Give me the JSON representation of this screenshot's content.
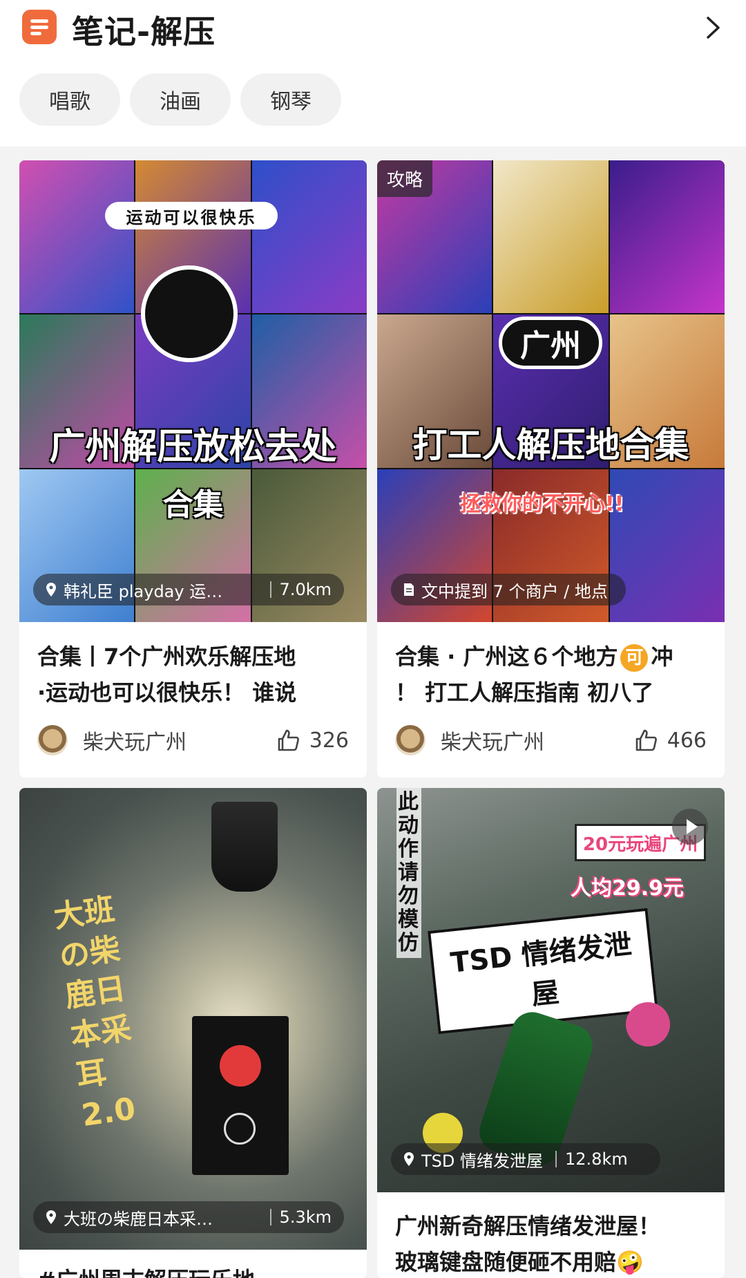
{
  "header": {
    "title": "笔记-解压",
    "icon": "notebook-icon",
    "accent": "#f06b3c"
  },
  "chips": [
    "唱歌",
    "油画",
    "钢琴"
  ],
  "cards": [
    {
      "cover_title_top": "运动可以很快乐",
      "cover_title_main": "广州解压放松去处",
      "cover_title_sub": "合集",
      "location": "韩礼臣 playday 运…",
      "distance": "7.0km",
      "caption_line1": "合集丨7个广州欢乐解压地",
      "caption_line2": "·运动也可以很快乐！ 谁说",
      "author": "柴犬玩广州",
      "likes": "326"
    },
    {
      "tag": "攻略",
      "cover_title_top": "广州",
      "cover_title_main": "打工人解压地合集",
      "cover_title_sub": "拯救你的不开心!!",
      "location": "文中提到 7 个商户 / 地点",
      "caption_line1": "合集 · 广州这６个地方",
      "caption_badge": "可",
      "caption_tail": "冲",
      "caption_line2": "！ 打工人解压指南 初八了",
      "author": "柴犬玩广州",
      "likes": "466"
    },
    {
      "cover_text": "大班の柴鹿日本采耳 2.0",
      "location": "大班の柴鹿日本采…",
      "distance": "5.3km",
      "caption_line1": "#广州周末解压玩乐地"
    },
    {
      "cover_side": "此动作请勿模仿",
      "cover_banner": "20元玩遍广州",
      "cover_price": "人均29.9元",
      "cover_title": "TSD 情绪发泄屋",
      "location": "TSD 情绪发泄屋",
      "distance": "12.8km",
      "caption_line1": "广州新奇解压情绪发泄屋！",
      "caption_line2": "玻璃键盘随便砸不用赔🤪"
    }
  ]
}
